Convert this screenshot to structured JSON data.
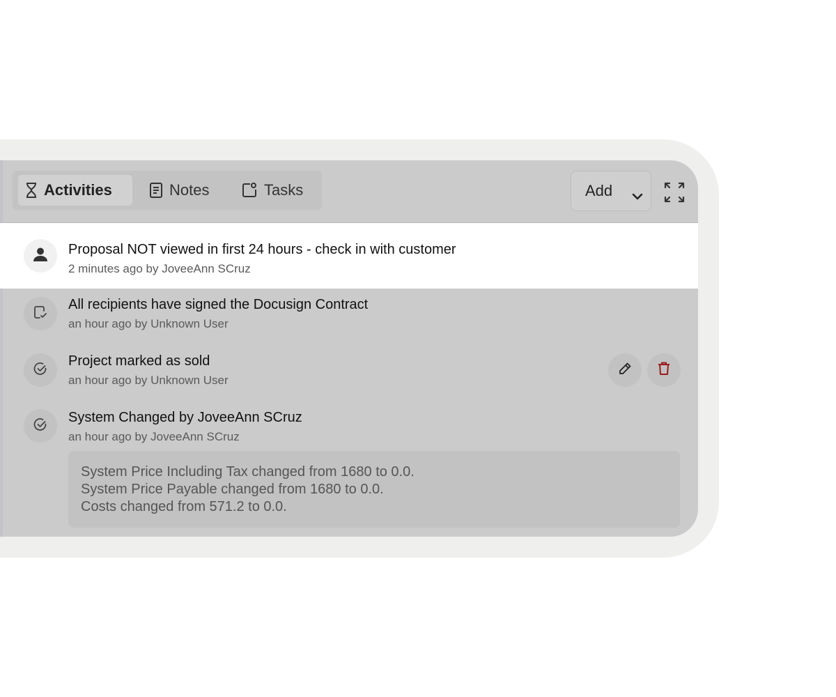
{
  "tabs": [
    {
      "label": "Activities",
      "icon": "hourglass-icon",
      "active": true
    },
    {
      "label": "Notes",
      "icon": "note-icon",
      "active": false
    },
    {
      "label": "Tasks",
      "icon": "task-icon",
      "active": false
    }
  ],
  "toolbar": {
    "add_label": "Add",
    "add_icon": "chevron-down-icon",
    "expand_icon": "expand-icon"
  },
  "activities": [
    {
      "title": "Proposal NOT viewed in first 24 hours - check in with customer",
      "meta": "2 minutes ago by JoveeAnn SCruz",
      "icon": "person-icon",
      "highlighted": true
    },
    {
      "title": "All recipients have signed the Docusign Contract",
      "meta": "an hour ago by Unknown User",
      "icon": "signed-document-icon"
    },
    {
      "title": "Project marked as sold",
      "meta": "an hour ago by Unknown User",
      "icon": "check-circle-icon",
      "actions": [
        "edit-icon",
        "trash-icon"
      ]
    },
    {
      "title": "System Changed by JoveeAnn SCruz",
      "meta": "an hour ago by JoveeAnn SCruz",
      "icon": "check-circle-icon",
      "details": [
        "System Price Including Tax changed from 1680 to 0.0.",
        "System Price Payable changed from 1680 to 0.0.",
        "Costs changed from 571.2 to 0.0."
      ]
    }
  ],
  "colors": {
    "panel": "#cbcbcb",
    "frame": "#efefee",
    "highlight_row": "#ffffff",
    "delete_red": "#9b1c1c",
    "text_primary": "#111111",
    "text_secondary": "#5a5a5a"
  }
}
